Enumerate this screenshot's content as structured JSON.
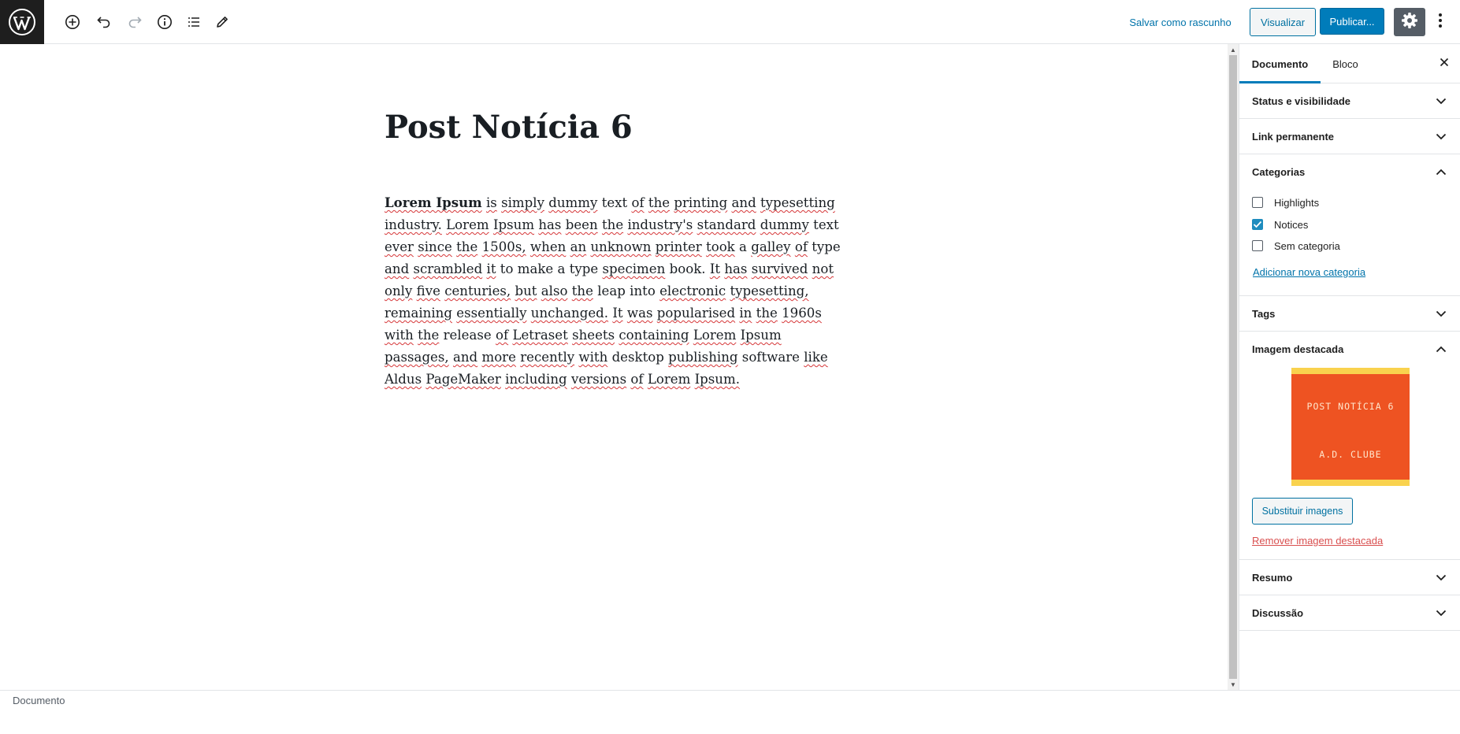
{
  "toolbar": {
    "save_draft_label": "Salvar como rascunho",
    "preview_label": "Visualizar",
    "publish_label": "Publicar..."
  },
  "post": {
    "title": "Post Notícia 6",
    "body_bold": "Lorem Ipsum",
    "body_words": [
      "is",
      "simply",
      "dummy",
      "text",
      "of",
      "the",
      "printing",
      "and",
      "typesetting",
      "industry.",
      "Lorem",
      "Ipsum",
      "has",
      "been",
      "the",
      "industry's",
      "standard",
      "dummy",
      "text",
      "ever",
      "since",
      "the",
      "1500s,",
      "when",
      "an",
      "unknown",
      "printer",
      "took",
      "a",
      "galley",
      "of",
      "type",
      "and",
      "scrambled",
      "it",
      "to",
      "make",
      "a",
      "type",
      "specimen",
      "book.",
      "It",
      "has",
      "survived",
      "not",
      "only",
      "five",
      "centuries,",
      "but",
      "also",
      "the",
      "leap",
      "into",
      "electronic",
      "typesetting,",
      "remaining",
      "essentially",
      "unchanged.",
      "It",
      "was",
      "popularised",
      "in",
      "the",
      "1960s",
      "with",
      "the",
      "release",
      "of",
      "Letraset",
      "sheets",
      "containing",
      "Lorem",
      "Ipsum",
      "passages,",
      "and",
      "more",
      "recently",
      "with",
      "desktop",
      "publishing",
      "software",
      "like",
      "Aldus",
      "PageMaker",
      "including",
      "versions",
      "of",
      "Lorem",
      "Ipsum."
    ],
    "body_unmarked_words": [
      "text",
      "type",
      "a",
      "to",
      "make",
      "book.",
      "leap",
      "into",
      "release",
      "desktop",
      "software"
    ]
  },
  "sidebar": {
    "tabs": [
      "Documento",
      "Bloco"
    ],
    "panels": {
      "status": "Status e visibilidade",
      "permalink": "Link permanente",
      "categories": "Categorias",
      "tags": "Tags",
      "featured_image": "Imagem destacada",
      "excerpt": "Resumo",
      "discussion": "Discussão"
    },
    "categories": [
      {
        "label": "Highlights",
        "checked": false
      },
      {
        "label": "Notices",
        "checked": true
      },
      {
        "label": "Sem categoria",
        "checked": false
      }
    ],
    "add_category_label": "Adicionar nova categoria",
    "featured_image_text": [
      "POST NOTÍCIA 6",
      "A.D. CLUBE"
    ],
    "replace_image_label": "Substituir imagens",
    "remove_image_label": "Remover imagem destacada"
  },
  "footer": {
    "breadcrumb": "Documento"
  },
  "colors": {
    "accent": "#007cba",
    "link": "#0073aa",
    "danger": "#d94f4f",
    "featured_bg": "#ee5322",
    "featured_border": "#f9d24e"
  },
  "icons": [
    "wordpress-logo-icon",
    "add-block-icon",
    "undo-icon",
    "redo-icon",
    "info-icon",
    "list-view-icon",
    "edit-tools-icon",
    "settings-gear-icon",
    "more-options-icon",
    "close-icon",
    "chevron-down-icon",
    "chevron-up-icon",
    "checkmark-icon"
  ]
}
